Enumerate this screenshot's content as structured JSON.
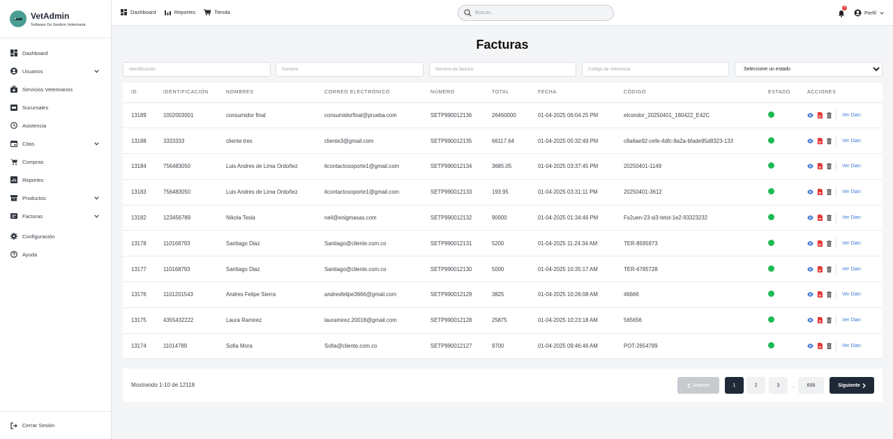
{
  "brand": {
    "title": "VetAdmin",
    "subtitle": "Software De Gestion Veterinaria"
  },
  "sidebar": {
    "items": [
      {
        "label": "Dashboard",
        "icon": "dashboard-icon",
        "chevron": false
      },
      {
        "label": "Usuarios",
        "icon": "user-circle-icon",
        "chevron": true
      },
      {
        "label": "Servicios Veterinarios",
        "icon": "medical-bag-icon",
        "chevron": false
      },
      {
        "label": "Sucursales",
        "icon": "store-icon",
        "chevron": false
      },
      {
        "label": "Asistencia",
        "icon": "clock-icon",
        "chevron": false
      },
      {
        "label": "Citas",
        "icon": "calendar-icon",
        "chevron": true
      },
      {
        "label": "Compras",
        "icon": "cart-icon",
        "chevron": false
      },
      {
        "label": "Reportes",
        "icon": "report-icon",
        "chevron": false
      },
      {
        "label": "Productos",
        "icon": "box-icon",
        "chevron": true
      },
      {
        "label": "Facturas",
        "icon": "invoice-icon",
        "chevron": true
      },
      {
        "label": "Configuración",
        "icon": "gear-icon",
        "chevron": false
      },
      {
        "label": "Ayuda",
        "icon": "help-icon",
        "chevron": false
      }
    ],
    "logout": "Cerrar Sesión"
  },
  "topnav": {
    "dashboard": "Dashboard",
    "reportes": "Reportes",
    "tienda": "Tienda"
  },
  "search": {
    "placeholder": "Buscar..."
  },
  "notifications": {
    "count": "3"
  },
  "profile": {
    "label": "Perfil"
  },
  "page": {
    "title": "Facturas"
  },
  "filters": {
    "identificacion": "Identificación",
    "nombre": "Nombre",
    "numero": "Número de factura",
    "codigo": "Código de referencia",
    "estado": "Seleccione un estado"
  },
  "table": {
    "headers": [
      "ID",
      "Identificación",
      "Nombres",
      "Correo electrónico",
      "Número",
      "Total",
      "Fecha",
      "Código",
      "Estado",
      "Acciones"
    ],
    "action_label": "Ver Dian",
    "status_color": "#1db954",
    "rows": [
      [
        "13189",
        "1002003001",
        "consumidor final",
        "consumidorfinal@prueba.com",
        "SETP990012136",
        "26460000",
        "01-04-2025 06:04:25 PM",
        "elcondor_20250401_180422_E42C"
      ],
      [
        "13188",
        "3333333",
        "cliente tres",
        "cliente3@gmail.com",
        "SETP990012135",
        "66117.64",
        "01-04-2025 05:32:49 PM",
        "c8a6ae92-cefe-4dfc-8a2a-bfade95d8323-133"
      ],
      [
        "13184",
        "756483050",
        "Luis Andres de Lima Ordoñez",
        "itcontactosoporte1@gmail.com",
        "SETP990012134",
        "3685.05",
        "01-04-2025 03:37:45 PM",
        "20250401-1149"
      ],
      [
        "13183",
        "756483050",
        "Luis Andres de Lima Ordoñez",
        "itcontactosoporte1@gmail.com",
        "SETP990012133",
        "193.95",
        "01-04-2025 03:31:11 PM",
        "20250401-3612"
      ],
      [
        "13182",
        "123456789",
        "Nikola Tesla",
        "neil@enigmasas.com",
        "SETP990012132",
        "90000",
        "01-04-2025 01:34:46 PM",
        "Fs2uen-23-sl3-tetst-1e2-93323232"
      ],
      [
        "13178",
        "110168793",
        "Santiago Diaz",
        "Santiago@cliente.com.co",
        "SETP990012131",
        "5200",
        "01-04-2025 11:24:34 AM",
        "TER-8595973"
      ],
      [
        "13177",
        "110168793",
        "Santiago Diaz",
        "Santiago@cliente.com.co",
        "SETP990012130",
        "5000",
        "01-04-2025 10:35:17 AM",
        "TER-6785728"
      ],
      [
        "13176",
        "1101201543",
        "Andres Felipe Sierra",
        "andresfelipe3666@gmail.com",
        "SETP990012129",
        "3825",
        "01-04-2025 10:26:08 AM",
        "46666"
      ],
      [
        "13175",
        "4355432222",
        "Laura Ramirez",
        "lauramirez.20018@gmail.com",
        "SETP990012128",
        "25875",
        "01-04-2025 10:23:18 AM",
        "565656"
      ],
      [
        "13174",
        "11014789",
        "Sofia Mora",
        "Sofia@cliente.com.co",
        "SETP990012127",
        "9700",
        "01-04-2025 09:46:46 AM",
        "POT-2654789"
      ]
    ]
  },
  "pagination": {
    "showing": "Mostrando 1-10 de 12118",
    "prev": "Anterior",
    "next": "Siguiente",
    "pages": [
      "1",
      "2",
      "3",
      "606"
    ],
    "ellipsis": "...",
    "active": "1"
  }
}
